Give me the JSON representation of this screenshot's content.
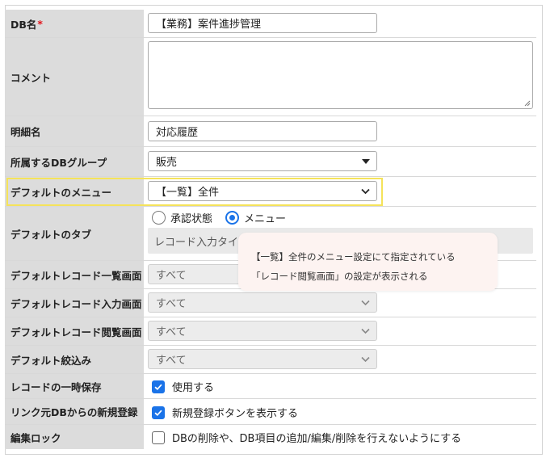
{
  "fields": {
    "db_name": {
      "label": "DB名",
      "required_mark": "*",
      "value": "【業務】案件進捗管理"
    },
    "comment": {
      "label": "コメント",
      "value": ""
    },
    "detail_name": {
      "label": "明細名",
      "value": "対応履歴"
    },
    "db_group": {
      "label": "所属するDBグループ",
      "value": "販売"
    },
    "default_menu": {
      "label": "デフォルトのメニュー",
      "value": "【一覧】全件"
    },
    "default_tab": {
      "label": "デフォルトのタブ",
      "options": [
        "承認状態",
        "メニュー"
      ],
      "selected": "メニュー",
      "box_text": "レコード入力タイプ"
    },
    "default_list_screen": {
      "label": "デフォルトレコード一覧画面",
      "value": "すべて"
    },
    "default_input_screen": {
      "label": "デフォルトレコード入力画面",
      "value": "すべて"
    },
    "default_view_screen": {
      "label": "デフォルトレコード閲覧画面",
      "value": "すべて"
    },
    "default_filter": {
      "label": "デフォルト絞込み",
      "value": "すべて"
    },
    "temp_save": {
      "label": "レコードの一時保存",
      "checkbox_label": "使用する",
      "checked": true
    },
    "link_new": {
      "label": "リンク元DBからの新規登録",
      "checkbox_label": "新規登録ボタンを表示する",
      "checked": true
    },
    "edit_lock": {
      "label": "編集ロック",
      "checkbox_label": "DBの削除や、DB項目の追加/編集/削除を行えないようにする",
      "checked": false
    }
  },
  "tooltip": {
    "line1": "【一覧】全件のメニュー設定にて指定されている",
    "line2": "「レコード閲覧画面」の設定が表示される"
  },
  "colors": {
    "label_bg": "#dcdcdc",
    "accent": "#1a73e8",
    "highlight": "#f5e35a",
    "required": "#e2131a",
    "tooltip_bg": "#fdf3f1"
  }
}
